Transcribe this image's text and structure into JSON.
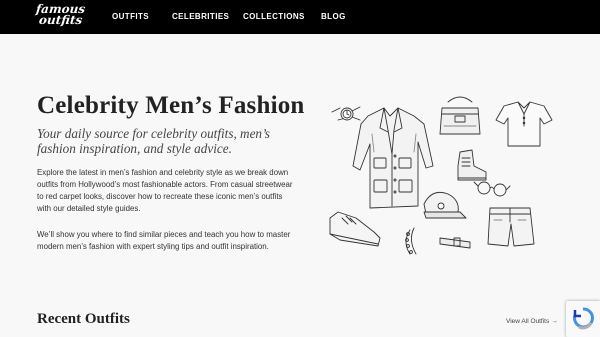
{
  "brand": {
    "line1": "famous",
    "line2": "outfits"
  },
  "nav": [
    {
      "label": "OUTFITS"
    },
    {
      "label": "CELEBRITIES"
    },
    {
      "label": "COLLECTIONS"
    },
    {
      "label": "BLOG"
    }
  ],
  "hero": {
    "title": "Celebrity Men’s Fashion",
    "subtitle": "Your daily source for celebrity outfits, men’s fashion inspiration, and style advice.",
    "paragraph1": "Explore the latest in men’s fashion and celebrity style as we break down outfits from Hollywood’s most fashionable actors. From casual streetwear to red carpet looks, discover how to recreate these iconic men’s outfits with our detailed style guides.",
    "paragraph2": "We’ll show you where to find similar pieces and teach you how to master modern men’s fashion with expert styling tips and outfit inspiration."
  },
  "recent": {
    "heading": "Recent Outfits",
    "view_all": "View All Outfits",
    "arrow": "→"
  },
  "colors": {
    "header_bg": "#000000",
    "page_bg": "#f8f8f8",
    "text": "#222222"
  },
  "icons": {
    "recaptcha": "recaptcha-icon",
    "illustration": "menswear-sketch-illustration"
  }
}
